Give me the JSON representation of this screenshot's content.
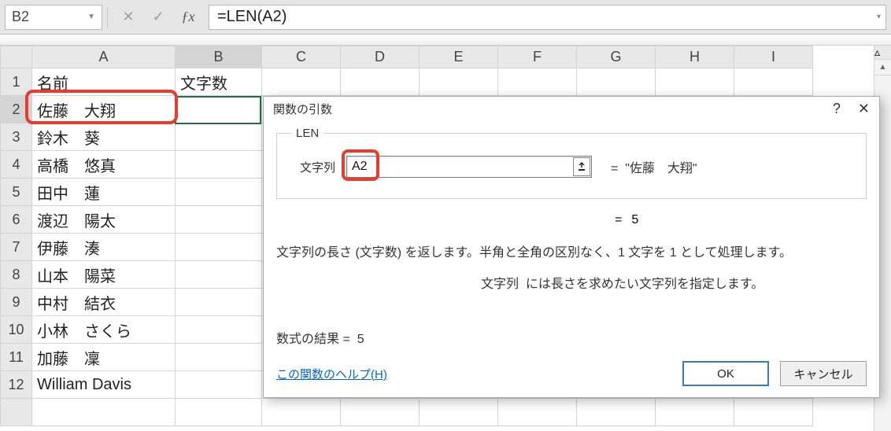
{
  "formula_bar": {
    "name_box": "B2",
    "formula": "=LEN(A2)"
  },
  "columns": [
    "A",
    "B",
    "C",
    "D",
    "E",
    "F",
    "G",
    "H",
    "I"
  ],
  "headers": {
    "A": "名前",
    "B": "文字数"
  },
  "rows": [
    {
      "n": 1
    },
    {
      "n": 2,
      "A": "佐藤　大翔"
    },
    {
      "n": 3,
      "A": "鈴木　葵"
    },
    {
      "n": 4,
      "A": "高橋　悠真"
    },
    {
      "n": 5,
      "A": "田中　蓮"
    },
    {
      "n": 6,
      "A": "渡辺　陽太"
    },
    {
      "n": 7,
      "A": "伊藤　湊"
    },
    {
      "n": 8,
      "A": "山本　陽菜"
    },
    {
      "n": 9,
      "A": "中村　結衣"
    },
    {
      "n": 10,
      "A": "小林　さくら"
    },
    {
      "n": 11,
      "A": "加藤　凜"
    },
    {
      "n": 12,
      "A": "William Davis"
    }
  ],
  "dialog": {
    "title": "関数の引数",
    "fn_name": "LEN",
    "arg_label": "文字列",
    "arg_value": "A2",
    "arg_eval": "\"佐藤　大翔\"",
    "result_value": "5",
    "desc1": "文字列の長さ (文字数) を返します。半角と全角の区別なく、1 文字を 1 として処理します。",
    "desc2_label": "文字列",
    "desc2_text": "には長さを求めたい文字列を指定します。",
    "formula_result_label": "数式の結果 =",
    "formula_result_value": "5",
    "help_link": "この関数のヘルプ(H)",
    "ok": "OK",
    "cancel": "キャンセル",
    "eq": "="
  }
}
